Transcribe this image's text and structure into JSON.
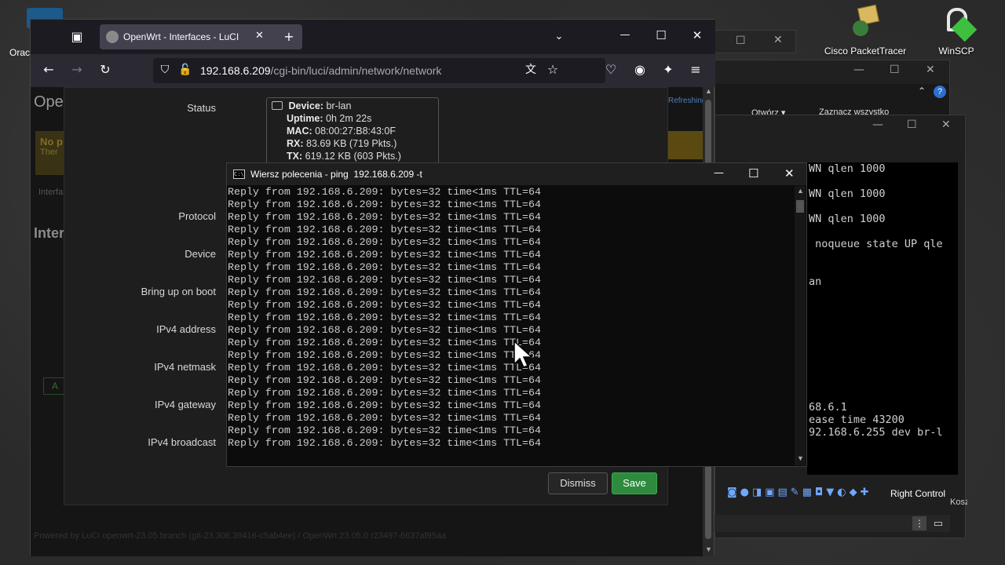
{
  "desktop": {
    "icons": [
      {
        "label": "Orac"
      },
      {
        "label": "Cisco PacketTracer"
      },
      {
        "label": "WinSCP"
      }
    ]
  },
  "browser": {
    "tab_title": "OpenWrt - Interfaces - LuCI",
    "url_host": "192.168.6.209",
    "url_path": "/cgi-bin/luci/admin/network/network",
    "page_title": "Ope",
    "bg_texts": {
      "no": "No p",
      "there": "Ther",
      "interf": "Interfa",
      "inter": "Inter",
      "a": "A",
      "footer": "Powered by LuCI openwrt-23.05 branch (git-23.306.39416-c5ab4ee) / OpenWrt 23.05.0 r23497-6637af95aa",
      "refresh": "Refreshing"
    },
    "modal": {
      "fields": [
        {
          "label": "Status"
        },
        {
          "label": "Protocol"
        },
        {
          "label": "Device"
        },
        {
          "label": "Bring up on boot"
        },
        {
          "label": "IPv4 address"
        },
        {
          "label": "IPv4 netmask"
        },
        {
          "label": "IPv4 gateway"
        },
        {
          "label": "IPv4 broadcast"
        }
      ],
      "status": {
        "device_key": "Device:",
        "device_val": "br-lan",
        "uptime_key": "Uptime:",
        "uptime_val": "0h 2m 22s",
        "mac_key": "MAC:",
        "mac_val": "08:00:27:B8:43:0F",
        "rx_key": "RX:",
        "rx_val": "83.69 KB (719 Pkts.)",
        "tx_key": "TX:",
        "tx_val": "619.12 KB (603 Pkts.)"
      },
      "dismiss_label": "Dismiss",
      "save_label": "Save"
    }
  },
  "cmd": {
    "title": "Wiersz polecenia - ping  192.168.6.209 -t",
    "lines": [
      "Reply from 192.168.6.209: bytes=32 time<1ms TTL=64",
      "Reply from 192.168.6.209: bytes=32 time<1ms TTL=64",
      "Reply from 192.168.6.209: bytes=32 time<1ms TTL=64",
      "Reply from 192.168.6.209: bytes=32 time<1ms TTL=64",
      "Reply from 192.168.6.209: bytes=32 time<1ms TTL=64",
      "Reply from 192.168.6.209: bytes=32 time<1ms TTL=64",
      "Reply from 192.168.6.209: bytes=32 time<1ms TTL=64",
      "Reply from 192.168.6.209: bytes=32 time<1ms TTL=64",
      "Reply from 192.168.6.209: bytes=32 time<1ms TTL=64",
      "Reply from 192.168.6.209: bytes=32 time<1ms TTL=64",
      "Reply from 192.168.6.209: bytes=32 time<1ms TTL=64",
      "Reply from 192.168.6.209: bytes=32 time<1ms TTL=64",
      "Reply from 192.168.6.209: bytes=32 time<1ms TTL=64",
      "Reply from 192.168.6.209: bytes=32 time<1ms TTL=64",
      "Reply from 192.168.6.209: bytes=32 time<1ms TTL=64",
      "Reply from 192.168.6.209: bytes=32 time<1ms TTL=64",
      "Reply from 192.168.6.209: bytes=32 time<1ms TTL=64",
      "Reply from 192.168.6.209: bytes=32 time<1ms TTL=64",
      "Reply from 192.168.6.209: bytes=32 time<1ms TTL=64",
      "Reply from 192.168.6.209: bytes=32 time<1ms TTL=64",
      "Reply from 192.168.6.209: bytes=32 time<1ms TTL=64"
    ]
  },
  "explorer": {
    "open_label": "Otwórz",
    "select_all_label": "Zaznacz wszystko"
  },
  "vm_terminal": {
    "lines": [
      "WN qlen 1000",
      "WN qlen 1000",
      "WN qlen 1000",
      " noqueue state UP qle",
      "an",
      "68.6.1",
      "ease time 43200",
      "92.168.6.255 dev br-l"
    ]
  },
  "vm_statusbar": {
    "host_key": "Right Control",
    "kosz": "Kosz"
  },
  "colors": {
    "save_button": "#2e8b3e",
    "cmd_bg": "#0c0c0c",
    "firefox_chrome": "#2b2a33"
  }
}
